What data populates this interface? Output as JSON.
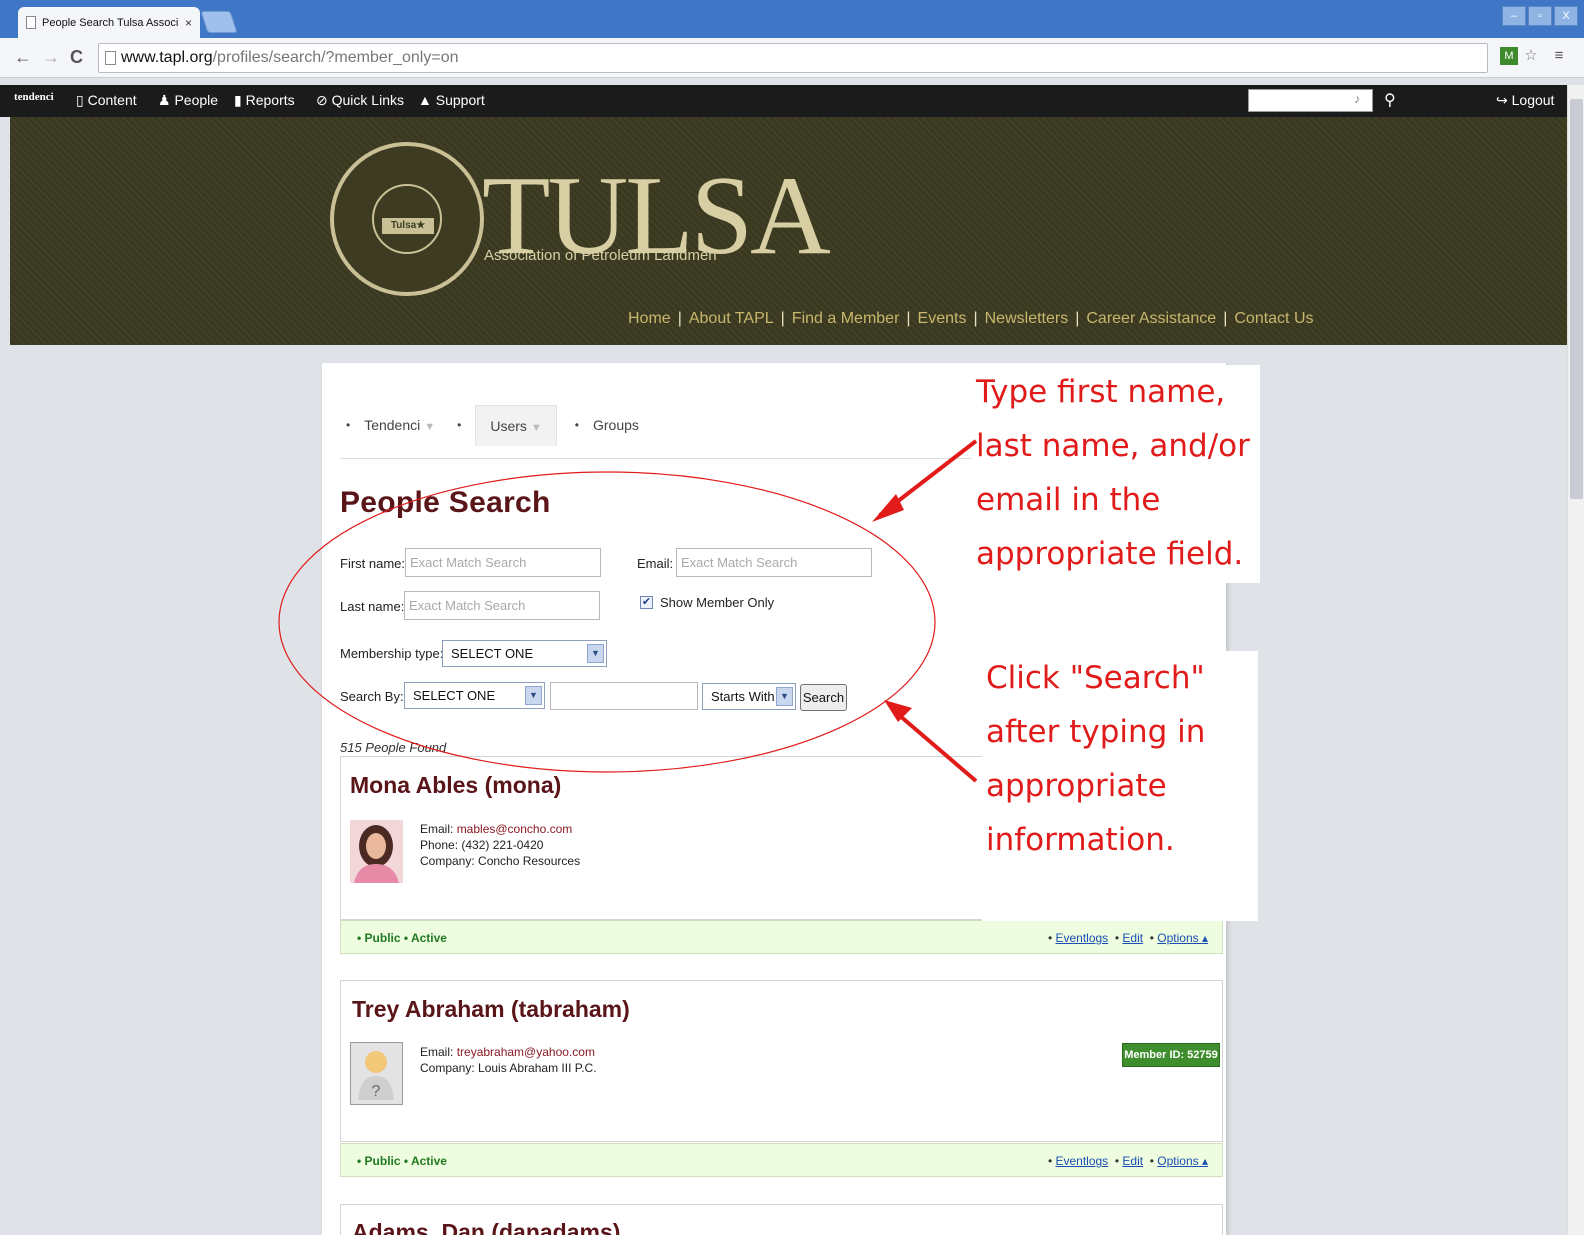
{
  "browser": {
    "tab_title": "People Search Tulsa Associat",
    "tab_close": "×",
    "url_host": "www.tapl.org",
    "url_path": "/profiles/search/?member_only=on",
    "window_buttons": [
      "–",
      "▫",
      "X"
    ]
  },
  "adminbar": {
    "logo": "tendenci",
    "items": [
      "Content",
      "People",
      "Reports",
      "Quick Links",
      "Support"
    ],
    "logout": "Logout"
  },
  "header": {
    "seal_label": "Tulsa★",
    "brand_title": "TULSA",
    "brand_subtitle": "Association of Petroleum Landmen",
    "nav": [
      "Home",
      "About TAPL",
      "Find a Member",
      "Events",
      "Newsletters",
      "Career Assistance",
      "Contact Us"
    ]
  },
  "subnav": {
    "items": [
      "Tendenci",
      "Users",
      "Groups"
    ]
  },
  "search": {
    "title": "People Search",
    "first_name_label": "First name:",
    "first_name_placeholder": "Exact Match Search",
    "last_name_label": "Last name:",
    "last_name_placeholder": "Exact Match Search",
    "email_label": "Email:",
    "email_placeholder": "Exact Match Search",
    "member_only_label": "Show Member Only",
    "membership_type_label": "Membership type:",
    "membership_type_value": "SELECT ONE",
    "search_by_label": "Search By:",
    "search_by_value": "SELECT ONE",
    "match_value": "Starts With",
    "search_button": "Search",
    "results_count": "515 People Found"
  },
  "people": [
    {
      "name": "Mona Ables (mona)",
      "email_label": "Email:",
      "email": "mables@concho.com",
      "phone": "Phone: (432) 221-0420",
      "company": "Company: Concho Resources",
      "status": "• Public  • Active"
    },
    {
      "name": "Trey Abraham (tabraham)",
      "email_label": "Email:",
      "email": "treyabraham@yahoo.com",
      "company": "Company: Louis Abraham III P.C.",
      "member_badge": "Member ID: 52759",
      "status": "• Public  • Active"
    },
    {
      "name": "Adams, Dan (danadams)"
    }
  ],
  "footer_links": {
    "eventlogs": "Eventlogs",
    "edit": "Edit",
    "options": "Options ▴"
  },
  "annotations": {
    "note1": [
      "Type first name,",
      "last name, and/or",
      "email in the",
      "appropriate field."
    ],
    "note2": [
      "Click \"Search\"",
      "after typing in",
      "appropriate",
      "information."
    ],
    "color": "#e11a1a"
  }
}
